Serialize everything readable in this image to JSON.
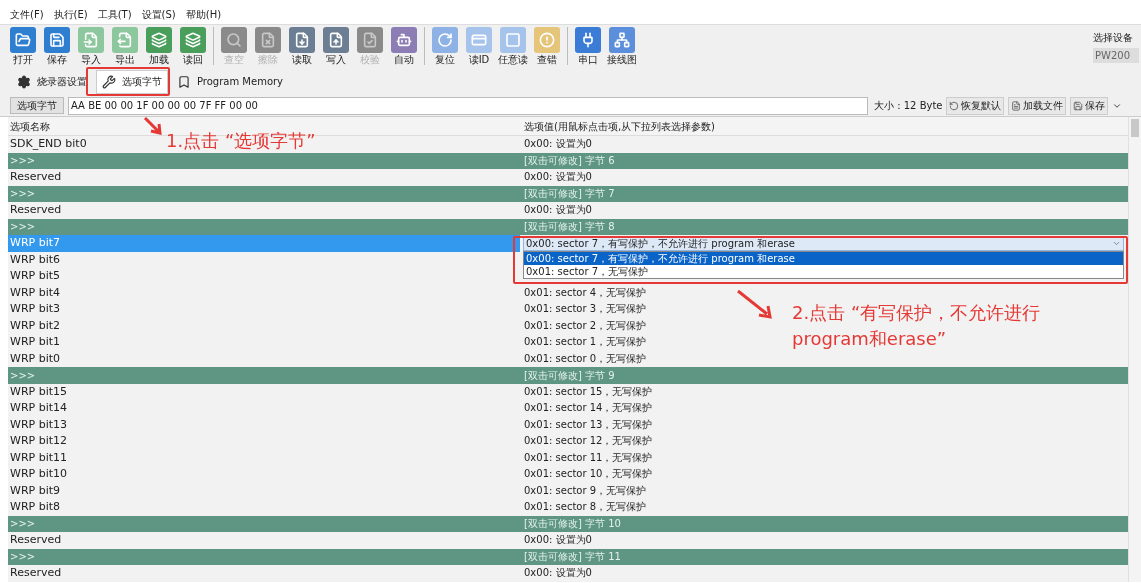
{
  "menu": [
    "文件(F)",
    "执行(E)",
    "工具(T)",
    "设置(S)",
    "帮助(H)"
  ],
  "toolbar": [
    {
      "kind": "button",
      "label": "打开",
      "color": "#2f7fd0",
      "disabled": false
    },
    {
      "kind": "button",
      "label": "保存",
      "color": "#2f7fd0",
      "disabled": false
    },
    {
      "kind": "button",
      "label": "导入",
      "color": "#8cc79e",
      "disabled": false
    },
    {
      "kind": "button",
      "label": "导出",
      "color": "#8cc79e",
      "disabled": false
    },
    {
      "kind": "button",
      "label": "加载",
      "color": "#4a9e5c",
      "disabled": false
    },
    {
      "kind": "button",
      "label": "读回",
      "color": "#4a9e5c",
      "disabled": false
    },
    {
      "kind": "separator"
    },
    {
      "kind": "button",
      "label": "查空",
      "color": "#8a8a8a",
      "disabled": true
    },
    {
      "kind": "button",
      "label": "擦除",
      "color": "#8a8a8a",
      "disabled": true
    },
    {
      "kind": "button",
      "label": "读取",
      "color": "#6b7e93",
      "disabled": false
    },
    {
      "kind": "button",
      "label": "写入",
      "color": "#6b7e93",
      "disabled": false
    },
    {
      "kind": "button",
      "label": "校验",
      "color": "#8a8a8a",
      "disabled": true
    },
    {
      "kind": "button",
      "label": "自动",
      "color": "#8c7db4",
      "disabled": false
    },
    {
      "kind": "separator"
    },
    {
      "kind": "button",
      "label": "复位",
      "color": "#8fb2e6",
      "disabled": false
    },
    {
      "kind": "button",
      "label": "读ID",
      "color": "#a6c3ec",
      "disabled": false
    },
    {
      "kind": "button",
      "label": "任意读",
      "color": "#a6c3ec",
      "disabled": false
    },
    {
      "kind": "button",
      "label": "查错",
      "color": "#e4c57a",
      "disabled": false
    },
    {
      "kind": "separator"
    },
    {
      "kind": "button",
      "label": "串口",
      "color": "#3b7dd6",
      "disabled": false
    },
    {
      "kind": "button",
      "label": "接线图",
      "color": "#5b8fdc",
      "disabled": false
    }
  ],
  "device": {
    "label": "选择设备",
    "value": "PW200"
  },
  "tabs": [
    {
      "label": "烧录器设置",
      "selected": false
    },
    {
      "label": "选项字节",
      "selected": true
    },
    {
      "label": "Program Memory",
      "selected": false
    }
  ],
  "option_bar": {
    "button": "选项字节",
    "value": "AA BE 00 00 1F 00 00 00 7F FF 00 00",
    "size": "大小 : 12 Byte",
    "buttons": [
      "恢复默认",
      "加载文件",
      "保存"
    ]
  },
  "table": {
    "columns": [
      "选项名称",
      "选项值(用鼠标点击项,从下拉列表选择参数)"
    ],
    "rows": [
      {
        "kind": "option",
        "name": "SDK_END bit0",
        "value": "0x00: 设置为0",
        "selected": false
      },
      {
        "kind": "group",
        "name": ">>>",
        "value": "[双击可修改] 字节 6"
      },
      {
        "kind": "option",
        "name": "Reserved",
        "value": "0x00: 设置为0",
        "selected": false
      },
      {
        "kind": "group",
        "name": ">>>",
        "value": "[双击可修改] 字节 7"
      },
      {
        "kind": "option",
        "name": "Reserved",
        "value": "0x00: 设置为0",
        "selected": false
      },
      {
        "kind": "group",
        "name": ">>>",
        "value": "[双击可修改] 字节 8"
      },
      {
        "kind": "option",
        "name": "WRP bit7",
        "selected": true,
        "dropdown": {
          "value": "0x00: sector 7，有写保护，不允许进行 program 和erase",
          "options": [
            {
              "label": "0x00: sector 7，有写保护，不允许进行 program 和erase",
              "selected": true
            },
            {
              "label": "0x01: sector 7，无写保护",
              "selected": false
            }
          ]
        }
      },
      {
        "kind": "option",
        "name": "WRP bit6",
        "selected": false
      },
      {
        "kind": "option",
        "name": "WRP bit5",
        "selected": false
      },
      {
        "kind": "option",
        "name": "WRP bit4",
        "value": "0x01: sector 4，无写保护",
        "selected": false
      },
      {
        "kind": "option",
        "name": "WRP bit3",
        "value": "0x01: sector 3，无写保护",
        "selected": false
      },
      {
        "kind": "option",
        "name": "WRP bit2",
        "value": "0x01: sector 2，无写保护",
        "selected": false
      },
      {
        "kind": "option",
        "name": "WRP bit1",
        "value": "0x01: sector 1，无写保护",
        "selected": false
      },
      {
        "kind": "option",
        "name": "WRP bit0",
        "value": "0x01: sector 0，无写保护",
        "selected": false
      },
      {
        "kind": "group",
        "name": ">>>",
        "value": "[双击可修改] 字节 9"
      },
      {
        "kind": "option",
        "name": "WRP bit15",
        "value": "0x01: sector 15，无写保护",
        "selected": false
      },
      {
        "kind": "option",
        "name": "WRP bit14",
        "value": "0x01: sector 14，无写保护",
        "selected": false
      },
      {
        "kind": "option",
        "name": "WRP bit13",
        "value": "0x01: sector 13，无写保护",
        "selected": false
      },
      {
        "kind": "option",
        "name": "WRP bit12",
        "value": "0x01: sector 12，无写保护",
        "selected": false
      },
      {
        "kind": "option",
        "name": "WRP bit11",
        "value": "0x01: sector 11，无写保护",
        "selected": false
      },
      {
        "kind": "option",
        "name": "WRP bit10",
        "value": "0x01: sector 10，无写保护",
        "selected": false
      },
      {
        "kind": "option",
        "name": "WRP bit9",
        "value": "0x01: sector 9，无写保护",
        "selected": false
      },
      {
        "kind": "option",
        "name": "WRP bit8",
        "value": "0x01: sector 8，无写保护",
        "selected": false
      },
      {
        "kind": "group",
        "name": ">>>",
        "value": "[双击可修改] 字节 10"
      },
      {
        "kind": "option",
        "name": "Reserved",
        "value": "0x00: 设置为0",
        "selected": false
      },
      {
        "kind": "group",
        "name": ">>>",
        "value": "[双击可修改] 字节 11"
      },
      {
        "kind": "option",
        "name": "Reserved",
        "value": "0x00: 设置为0",
        "selected": false
      }
    ]
  },
  "annotations": [
    "1.点击 “选项字节”",
    "2.点击 “有写保护，不允许进行 program和erase”"
  ]
}
